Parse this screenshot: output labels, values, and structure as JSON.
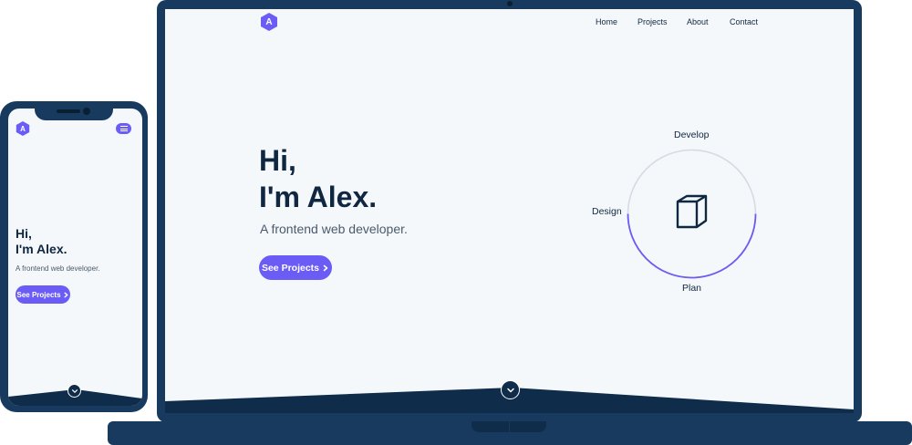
{
  "site": {
    "logo_letter": "A",
    "nav": [
      {
        "label": "Home"
      },
      {
        "label": "Projects"
      },
      {
        "label": "About"
      },
      {
        "label": "Contact"
      }
    ],
    "hero": {
      "line1": "Hi,",
      "line2": "I'm Alex.",
      "subtitle": "A frontend web developer.",
      "cta_label": "See Projects"
    },
    "cycle": {
      "top": "Develop",
      "left": "Design",
      "bottom": "Plan",
      "center_icon": "cube-icon"
    }
  },
  "icons": {
    "logo": "hexagon-logo-icon",
    "menu": "hamburger-menu-icon",
    "cta_arrow": "chevron-right-icon",
    "scroll": "chevron-down-icon"
  },
  "colors": {
    "accent": "#6a5cf5",
    "navy": "#0f2740",
    "device": "#173a5e",
    "background": "#f5f8fb",
    "ring": "#d6dbe3"
  }
}
